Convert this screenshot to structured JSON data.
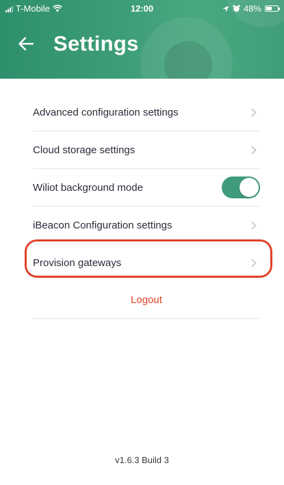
{
  "status_bar": {
    "carrier": "T-Mobile",
    "time": "12:00",
    "battery_percent": "48%",
    "battery_level": 0.48,
    "icons": [
      "signal-icon",
      "wifi-icon",
      "location-icon",
      "alarm-icon",
      "battery-icon"
    ]
  },
  "header": {
    "title": "Settings",
    "back_icon": "arrow-left-icon",
    "color": "#3e9e78"
  },
  "settings": {
    "items": [
      {
        "label": "Advanced configuration settings",
        "control": "chevron"
      },
      {
        "label": "Cloud storage settings",
        "control": "chevron"
      },
      {
        "label": "Wiliot background mode",
        "control": "toggle",
        "value": true
      },
      {
        "label": "iBeacon Configuration settings",
        "control": "chevron"
      },
      {
        "label": "Provision gateways",
        "control": "chevron",
        "highlighted": true
      }
    ],
    "logout_label": "Logout",
    "logout_color": "#e0412a",
    "toggle_on_color": "#3f9b7a"
  },
  "footer": {
    "version": "v1.6.3 Build 3"
  }
}
